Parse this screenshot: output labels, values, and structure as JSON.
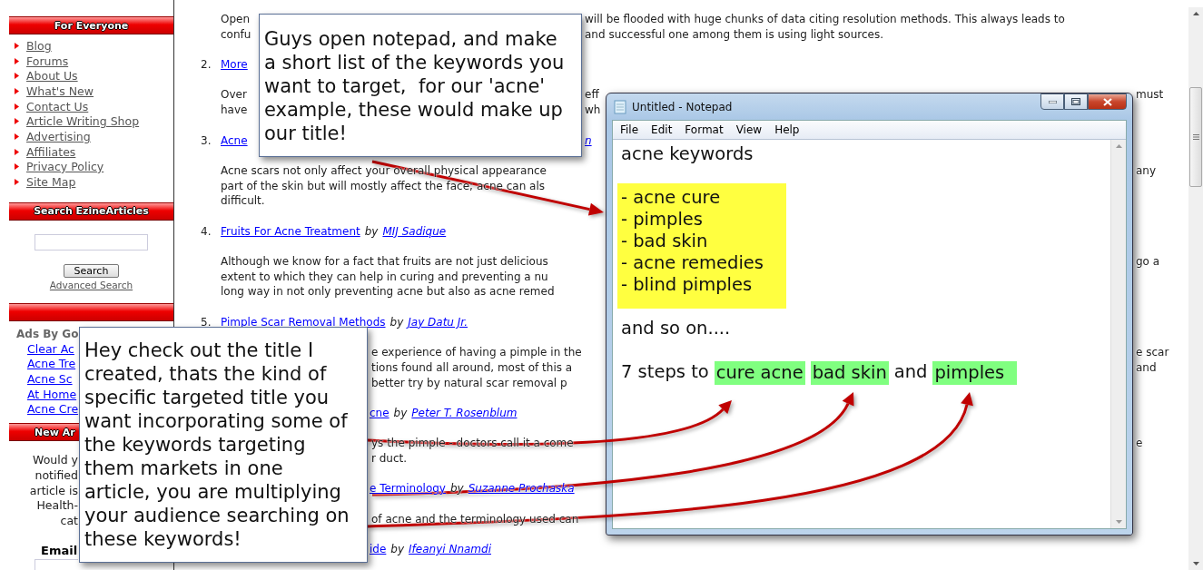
{
  "sidebar": {
    "sections": [
      {
        "kind": "links",
        "title": "For Everyone",
        "links": [
          "Blog",
          "Forums",
          "About Us",
          "What's New",
          "Contact Us",
          "Article Writing Shop",
          "Advertising",
          "Affiliates",
          "Privacy Policy",
          "Site Map"
        ]
      },
      {
        "kind": "search",
        "title": "Search EzineArticles",
        "button": "Search",
        "link": "Advanced Search"
      },
      {
        "kind": "ads",
        "label": "Ads By Go",
        "links": [
          "Clear Ac",
          "Acne Tre",
          "Acne Sc",
          "At Home",
          "Acne Cre"
        ]
      },
      {
        "kind": "newsletter",
        "title": "New Ar",
        "lines": [
          "Would y",
          "notified",
          "article is",
          "Health-",
          "cat"
        ],
        "email_label": "Email"
      }
    ]
  },
  "content": {
    "beside_top_note": [
      {
        "kind": "paragraph",
        "lines": [
          {
            "start": "Open",
            "mid": "will be flooded with huge chunks of data citing resolution methods. This always leads to"
          },
          {
            "start": "confu",
            "mid": "and successful one among them is using light sources."
          }
        ]
      },
      {
        "kind": "heading",
        "number": "2.",
        "title": "More"
      },
      {
        "kind": "paragraph",
        "lines": [
          {
            "start": "Over",
            "mid": "eff",
            "end": "must"
          },
          {
            "start": "have",
            "mid": "wh"
          }
        ]
      },
      {
        "kind": "heading",
        "number": "3.",
        "title": "Acne",
        "author": "n"
      }
    ],
    "clear": [
      {
        "kind": "paragraph",
        "lines": [
          {
            "start": "Acne scars not only affect your overall physical appearance",
            "end": "any"
          },
          {
            "start": "part of the skin but will mostly affect the face; acne can als"
          },
          {
            "start": "difficult."
          }
        ]
      },
      {
        "kind": "heading",
        "number": "4.",
        "title": "Fruits For Acne Treatment",
        "by": "by",
        "author": "MIJ Sadique"
      },
      {
        "kind": "paragraph",
        "lines": [
          {
            "start": "Although we know for a fact that fruits are not just delicious",
            "end": "go a"
          },
          {
            "start": "extent to which they can help in curing and preventing a nu"
          },
          {
            "start": "long way in not only preventing acne but also as acne remed"
          }
        ]
      },
      {
        "kind": "heading",
        "number": "5.",
        "title": "Pimple Scar Removal Methods",
        "by": "by",
        "author": "Jay Datu Jr."
      }
    ],
    "beside_bottom_note": [
      {
        "kind": "paragraph",
        "lines": [
          {
            "mid": "e experience of having a pimple in the",
            "end": "e scar"
          },
          {
            "mid": "tions found all around, most of this a",
            "end": "and"
          },
          {
            "mid": "better try by natural scar removal p"
          }
        ]
      },
      {
        "kind": "heading",
        "title": "cne",
        "by": "by",
        "author": "Peter T. Rosenblum"
      },
      {
        "kind": "paragraph",
        "lines": [
          {
            "mid": "ys the pimple - doctors call it a come",
            "end": "e"
          },
          {
            "mid": "r duct."
          }
        ]
      },
      {
        "kind": "heading",
        "title": "e Terminology",
        "by": "by",
        "author": "Suzanne Prochaska"
      },
      {
        "kind": "paragraph",
        "lines": [
          {
            "mid": "of acne and the terminology used can"
          }
        ]
      },
      {
        "kind": "heading",
        "title": "ide",
        "by": "by",
        "author": "Ifeanyi Nnamdi"
      }
    ]
  },
  "callouts": [
    {
      "kind": "top",
      "lines": [
        "Guys open notepad, and make",
        "a short list of the keywords you",
        "want to target,  for our 'acne'",
        "example, these would make up",
        "our title!"
      ]
    },
    {
      "kind": "bottom",
      "lines": [
        "Hey check out the title I",
        "created, thats the kind of",
        "specific targeted title you",
        "want incorporating some of",
        "the keywords targeting",
        "them markets in one",
        "article, you are multiplying",
        "your audience searching on",
        "these keywords!"
      ]
    }
  ],
  "notepad": {
    "title": "Untitled - Notepad",
    "menu": [
      "File",
      "Edit",
      "Format",
      "View",
      "Help"
    ],
    "lines": [
      {
        "kind": "text",
        "text": "acne keywords"
      },
      {
        "kind": "blank"
      },
      {
        "kind": "block",
        "lines": [
          "- acne cure",
          "- pimples",
          "- bad skin",
          "- acne remedies",
          "- blind pimples"
        ]
      },
      {
        "kind": "blank"
      },
      {
        "kind": "text",
        "text": "and so on...."
      },
      {
        "kind": "blank"
      },
      {
        "kind": "mixed",
        "parts": [
          {
            "text": "7 steps to",
            "highlighted": false
          },
          {
            "text": "cure acne",
            "highlighted": true
          },
          {
            "text": "bad skin",
            "highlighted": true
          },
          {
            "text": "and",
            "highlighted": false
          },
          {
            "text": "pimples",
            "highlighted": true
          }
        ]
      }
    ]
  }
}
